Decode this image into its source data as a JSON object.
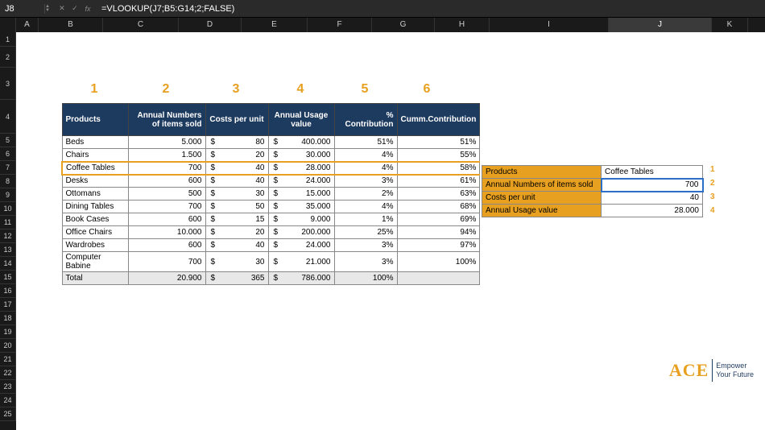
{
  "formula_bar": {
    "cell_ref": "J8",
    "formula": "=VLOOKUP(J7;B5:G14;2;FALSE)"
  },
  "columns": [
    "A",
    "B",
    "C",
    "D",
    "E",
    "F",
    "G",
    "H",
    "I",
    "J",
    "K"
  ],
  "selected_column": "J",
  "rows": [
    "1",
    "2",
    "3",
    "4",
    "5",
    "6",
    "7",
    "8",
    "9",
    "10",
    "11",
    "12",
    "13",
    "14",
    "15",
    "16",
    "17",
    "18",
    "19",
    "20",
    "21",
    "22",
    "23",
    "24",
    "25"
  ],
  "top_labels": [
    "1",
    "2",
    "3",
    "4",
    "5",
    "6"
  ],
  "headers": {
    "products": "Products",
    "items_sold": "Annual Numbers of items sold",
    "costs": "Costs per unit",
    "usage": "Annual Usage value",
    "pct": "% Contribution",
    "cum": "Cumm.Contribution"
  },
  "data_rows": [
    {
      "product": "Beds",
      "items": "5.000",
      "cost": "80",
      "usage": "400.000",
      "pct": "51%",
      "cum": "51%",
      "hl": false
    },
    {
      "product": "Chairs",
      "items": "1.500",
      "cost": "20",
      "usage": "30.000",
      "pct": "4%",
      "cum": "55%",
      "hl": false
    },
    {
      "product": "Coffee Tables",
      "items": "700",
      "cost": "40",
      "usage": "28.000",
      "pct": "4%",
      "cum": "58%",
      "hl": true
    },
    {
      "product": "Desks",
      "items": "600",
      "cost": "40",
      "usage": "24.000",
      "pct": "3%",
      "cum": "61%",
      "hl": false
    },
    {
      "product": "Ottomans",
      "items": "500",
      "cost": "30",
      "usage": "15.000",
      "pct": "2%",
      "cum": "63%",
      "hl": false
    },
    {
      "product": "Dining Tables",
      "items": "700",
      "cost": "50",
      "usage": "35.000",
      "pct": "4%",
      "cum": "68%",
      "hl": false
    },
    {
      "product": "Book Cases",
      "items": "600",
      "cost": "15",
      "usage": "9.000",
      "pct": "1%",
      "cum": "69%",
      "hl": false
    },
    {
      "product": "Office Chairs",
      "items": "10.000",
      "cost": "20",
      "usage": "200.000",
      "pct": "25%",
      "cum": "94%",
      "hl": false
    },
    {
      "product": "Wardrobes",
      "items": "600",
      "cost": "40",
      "usage": "24.000",
      "pct": "3%",
      "cum": "97%",
      "hl": false
    },
    {
      "product": "Computer Babine",
      "items": "700",
      "cost": "30",
      "usage": "21.000",
      "pct": "3%",
      "cum": "100%",
      "hl": false
    }
  ],
  "total_row": {
    "label": "Total",
    "items": "20.900",
    "cost": "365",
    "usage": "786.000",
    "pct": "100%",
    "cum": ""
  },
  "currency": "$",
  "lookup": {
    "rows": [
      {
        "label": "Products",
        "value": "Coffee Tables",
        "left": true,
        "selected": false
      },
      {
        "label": "Annual Numbers of items sold",
        "value": "700",
        "left": false,
        "selected": true
      },
      {
        "label": "Costs per unit",
        "value": "40",
        "left": false,
        "selected": false
      },
      {
        "label": "Annual Usage value",
        "value": "28.000",
        "left": false,
        "selected": false
      }
    ]
  },
  "side_labels": [
    "1",
    "2",
    "3",
    "4"
  ],
  "logo": {
    "brand": "ACE",
    "line1": "Empower",
    "line2": "Your Future"
  }
}
